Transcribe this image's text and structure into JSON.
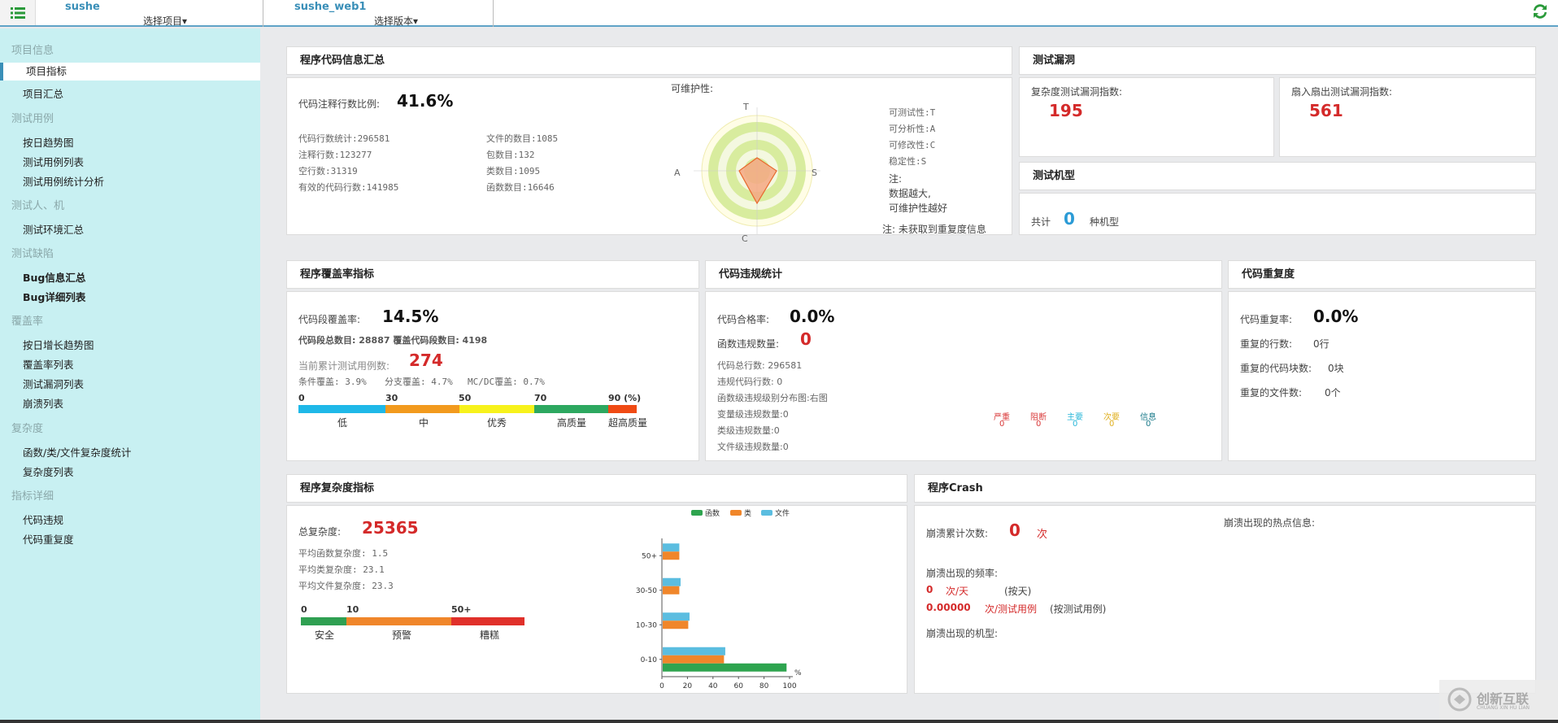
{
  "topbar": {
    "project1_name": "sushe",
    "project1_select": "选择项目▾",
    "project2_name": "sushe_web1",
    "project2_select": "选择版本▾"
  },
  "sidebar": {
    "g1": "项目信息",
    "i1a": "项目指标",
    "i1b": "项目汇总",
    "g2": "测试用例",
    "i2a": "按日趋势图",
    "i2b": "测试用例列表",
    "i2c": "测试用例统计分析",
    "g3": "测试人、机",
    "i3a": "测试环境汇总",
    "g4": "测试缺陷",
    "i4a": "Bug信息汇总",
    "i4b": "Bug详细列表",
    "g5": "覆盖率",
    "i5a": "按日增长趋势图",
    "i5b": "覆盖率列表",
    "i5c": "测试漏洞列表",
    "i5d": "崩溃列表",
    "g6": "复杂度",
    "i6a": "函数/类/文件复杂度统计",
    "i6b": "复杂度列表",
    "g7": "指标详细",
    "i7a": "代码违规",
    "i7b": "代码重复度"
  },
  "code_summary": {
    "title": "程序代码信息汇总",
    "comment_ratio_label": "代码注释行数比例:",
    "comment_ratio": "41.6%",
    "l1": "代码行数统计:296581",
    "l2": "注释行数:123277",
    "l3": "空行数:31319",
    "l4": "有效的代码行数:141985",
    "r1": "文件的数目:1085",
    "r2": "包数目:132",
    "r3": "类数目:1095",
    "r4": "函数数目:16646",
    "maint_label": "可维护性:",
    "axis_t": "T",
    "axis_s": "S",
    "axis_c": "C",
    "axis_a": "A",
    "m1": "可测试性:T",
    "m2": "可分析性:A",
    "m3": "可修改性:C",
    "m4": "稳定性:S",
    "note1": "注:",
    "note2": "数据越大,",
    "note3": "可维护性越好",
    "note4": "注: 未获取到重复度信息"
  },
  "test_vuln": {
    "title": "测试漏洞",
    "complex_label": "复杂度测试漏洞指数:",
    "complex_value": "195",
    "fanin_label": "扇入扇出测试漏洞指数:",
    "fanin_value": "561"
  },
  "test_machine": {
    "title": "测试机型",
    "total_label": "共计",
    "total_value": "0",
    "unit": "种机型"
  },
  "coverage": {
    "title": "程序覆盖率指标",
    "seg_label": "代码段覆盖率:",
    "seg_value": "14.5%",
    "seg_detail": "代码段总数目: 28887  覆盖代码段数目: 4198",
    "case_label": "当前累计测试用例数:",
    "case_value": "274",
    "cond": "条件覆盖: 3.9%",
    "branch": "分支覆盖: 4.7%",
    "mcdc": "MC/DC覆盖: 0.7%",
    "scale": [
      "0",
      "30",
      "50",
      "70",
      "90 (%)"
    ],
    "levels": [
      "低",
      "中",
      "优秀",
      "高质量",
      "超高质量"
    ]
  },
  "violation": {
    "title": "代码违规统计",
    "pass_label": "代码合格率:",
    "pass_value": "0.0%",
    "func_label": "函数违规数量:",
    "func_value": "0",
    "total": "代码总行数: 296581",
    "viol_lines": "违规代码行数: 0",
    "dist": "函数级违规级别分布图:右图",
    "var": "变量级违规数量:0",
    "cls": "类级违规数量:0",
    "file": "文件级违规数量:0",
    "sev_labels": [
      "严重",
      "阻断",
      "主要",
      "次要",
      "信息"
    ],
    "sev_values": [
      "0",
      "0",
      "0",
      "0",
      "0"
    ]
  },
  "duplication": {
    "title": "代码重复度",
    "rate_label": "代码重复率:",
    "rate_value": "0.0%",
    "lines_label": "重复的行数:",
    "lines_value": "0行",
    "blocks_label": "重复的代码块数:",
    "blocks_value": "0块",
    "files_label": "重复的文件数:",
    "files_value": "0个"
  },
  "complexity": {
    "title": "程序复杂度指标",
    "total_label": "总复杂度:",
    "total_value": "25365",
    "avg_func": "平均函数复杂度: 1.5",
    "avg_class": "平均类复杂度: 23.1",
    "avg_file": "平均文件复杂度: 23.3",
    "scale": [
      "0",
      "10",
      "50+"
    ],
    "levels": [
      "安全",
      "预警",
      "糟糕"
    ]
  },
  "chart_data": {
    "type": "bar",
    "orientation": "horizontal",
    "categories": [
      "0-10",
      "10-30",
      "30-50",
      "50+"
    ],
    "series": [
      {
        "name": "函数",
        "color": "#2ea44f",
        "values": [
          97,
          0,
          0,
          0
        ]
      },
      {
        "name": "类",
        "color": "#f0862a",
        "values": [
          48,
          20,
          13,
          13
        ]
      },
      {
        "name": "文件",
        "color": "#5bbde0",
        "values": [
          49,
          21,
          14,
          13
        ]
      }
    ],
    "xlim": [
      0,
      100
    ],
    "xticks": [
      "0",
      "20",
      "40",
      "60",
      "80",
      "100"
    ],
    "xunit": "%",
    "legend": "top"
  },
  "crash": {
    "title": "程序Crash",
    "count_label": "崩溃累计次数:",
    "count_value": "0",
    "count_unit": "次",
    "hot_label": "崩溃出现的热点信息:",
    "freq_label": "崩溃出现的频率:",
    "f1_value": "0",
    "f1_unit": "次/天",
    "f1_note": "(按天)",
    "f2_value": "0.00000",
    "f2_unit": "次/测试用例",
    "f2_note": "(按测试用例)",
    "model_label": "崩溃出现的机型:"
  },
  "watermark": {
    "text": "创新互联",
    "sub": "CHUANG XIN HU LIAN"
  }
}
